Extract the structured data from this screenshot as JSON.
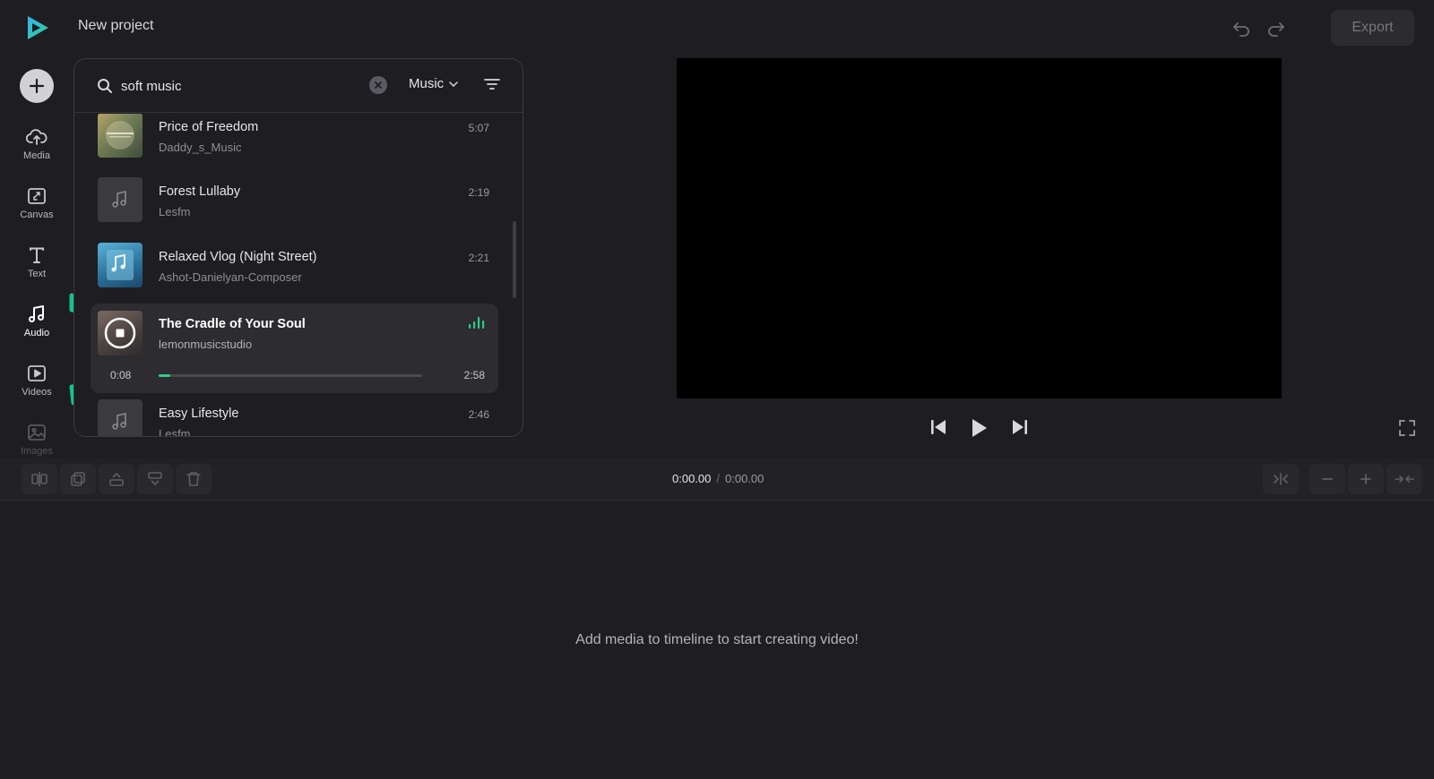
{
  "header": {
    "logo_icon": "play-logo-icon",
    "project_title": "New project",
    "undo_icon": "undo-icon",
    "redo_icon": "redo-icon",
    "export_label": "Export"
  },
  "sidebar": {
    "add_icon": "plus-icon",
    "items": [
      {
        "label": "Media",
        "icon": "upload-cloud-icon"
      },
      {
        "label": "Canvas",
        "icon": "canvas-icon"
      },
      {
        "label": "Text",
        "icon": "text-icon"
      },
      {
        "label": "Audio",
        "icon": "music-note-icon",
        "active": true
      },
      {
        "label": "Videos",
        "icon": "video-icon"
      },
      {
        "label": "Images",
        "icon": "image-icon"
      }
    ]
  },
  "library": {
    "search": {
      "value": "soft music",
      "placeholder": "Search"
    },
    "type_filter": "Music",
    "tracks": [
      {
        "title": "Price of Freedom",
        "artist": "Daddy_s_Music",
        "duration": "5:07",
        "thumb": "album-art"
      },
      {
        "title": "Forest Lullaby",
        "artist": "Lesfm",
        "duration": "2:19",
        "thumb": "music-note-icon"
      },
      {
        "title": "Relaxed Vlog (Night Street)",
        "artist": "Ashot-Danielyan-Composer",
        "duration": "2:21",
        "thumb": "album-art"
      },
      {
        "title": "The Cradle of Your Soul",
        "artist": "lemonmusicstudio",
        "current_time": "0:08",
        "duration": "2:58",
        "progress": 0.045,
        "playing": true
      },
      {
        "title": "Easy Lifestyle",
        "artist": "Lesfm",
        "duration": "2:46",
        "thumb": "music-note-icon"
      }
    ]
  },
  "preview": {
    "controls": [
      "skip-back-icon",
      "play-icon",
      "skip-forward-icon"
    ],
    "fullscreen_icon": "fullscreen-icon"
  },
  "timeline": {
    "current_time": "0:00.00",
    "separator": "/",
    "total_time": "0:00.00",
    "empty_message": "Add media to timeline to start creating video!"
  },
  "colors": {
    "accent": "#2ecc8a",
    "background": "#1e1e22",
    "annotation_arrow": "#12c48a"
  }
}
